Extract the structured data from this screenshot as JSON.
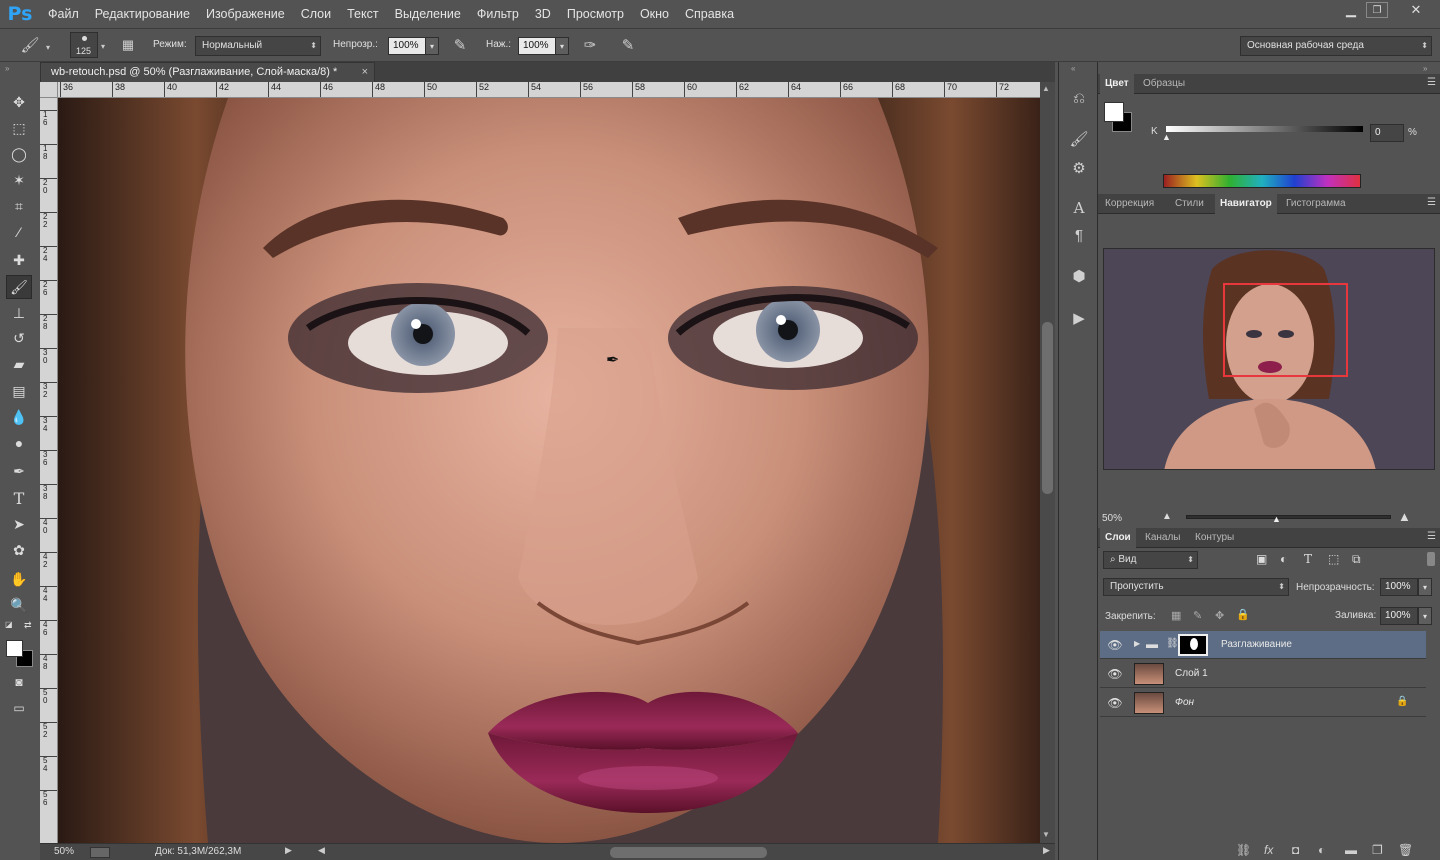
{
  "app": {
    "logo": "Ps"
  },
  "menu": [
    "Файл",
    "Редактирование",
    "Изображение",
    "Слои",
    "Текст",
    "Выделение",
    "Фильтр",
    "3D",
    "Просмотр",
    "Окно",
    "Справка"
  ],
  "options": {
    "brush_size": "125",
    "mode_label": "Режим:",
    "mode_value": "Нормальный",
    "opacity_label": "Непрозр.:",
    "opacity_value": "100%",
    "pressure_label": "Наж.:",
    "pressure_value": "100%",
    "workspace": "Основная рабочая среда"
  },
  "document": {
    "tab_title": "wb-retouch.psd @ 50% (Разглаживание, Слой-маска/8) *",
    "close": "×",
    "ruler_h": [
      "36",
      "38",
      "40",
      "42",
      "44",
      "46",
      "48",
      "50",
      "52",
      "54",
      "56",
      "58",
      "60",
      "62",
      "64",
      "66",
      "68",
      "70",
      "72"
    ],
    "ruler_v": [
      "1 6",
      "1 8",
      "2 0",
      "2 2",
      "2 4",
      "2 6",
      "2 8",
      "3 0",
      "3 2",
      "3 4",
      "3 6",
      "3 8",
      "4 0",
      "4 2",
      "4 4",
      "4 6",
      "4 8",
      "5 0",
      "5 2",
      "5 4",
      "5 6"
    ],
    "status_zoom": "50%",
    "status_doc": "Док: 51,3M/262,3M"
  },
  "color_panel": {
    "tabs": [
      "Цвет",
      "Образцы"
    ],
    "channel_label": "K",
    "channel_value": "0",
    "unit": "%"
  },
  "navigator_panel": {
    "tabs": [
      "Коррекция",
      "Стили",
      "Навигатор",
      "Гистограмма"
    ],
    "zoom": "50%"
  },
  "layers_panel": {
    "tabs": [
      "Слои",
      "Каналы",
      "Контуры"
    ],
    "filter_label": "Вид",
    "blend_mode": "Пропустить",
    "opacity_label": "Непрозрачность:",
    "opacity_value": "100%",
    "lock_label": "Закрепить:",
    "fill_label": "Заливка:",
    "fill_value": "100%",
    "layers": [
      {
        "name": "Разглаживание"
      },
      {
        "name": "Слой 1"
      },
      {
        "name": "Фон"
      }
    ]
  },
  "colors": {
    "accent": "#2fa3f6",
    "selected_layer": "#5d6d85",
    "nav_frame": "#e8383d",
    "lips": "#8e1f4c"
  }
}
